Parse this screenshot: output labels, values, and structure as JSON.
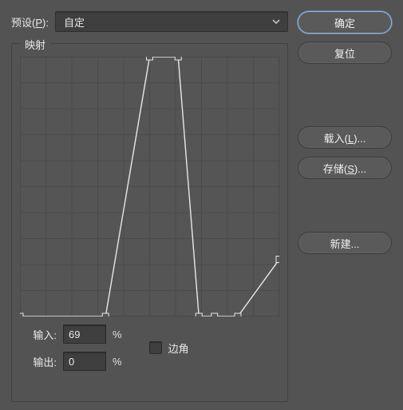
{
  "preset": {
    "label_before": "预设(",
    "label_hotkey": "P",
    "label_after": "):",
    "value": "自定"
  },
  "mapping": {
    "legend": "映射"
  },
  "chart_data": {
    "type": "line",
    "x": [
      0,
      33,
      50,
      61,
      69,
      75,
      84,
      100
    ],
    "y": [
      0,
      0,
      100,
      100,
      0,
      0,
      0,
      22
    ],
    "xlim": [
      0,
      100
    ],
    "ylim": [
      0,
      100
    ],
    "grid": true,
    "title": "",
    "xlabel": "",
    "ylabel": ""
  },
  "io": {
    "input_label": "输入:",
    "input_value": "69",
    "output_label": "输出:",
    "output_value": "0",
    "percent": "%"
  },
  "corner": {
    "label": "边角",
    "checked": false
  },
  "buttons": {
    "ok": "确定",
    "reset": "复位",
    "load_pre": "载入(",
    "load_hot": "L",
    "load_post": ")...",
    "save_pre": "存储(",
    "save_hot": "S",
    "save_post": ")...",
    "new": "新建..."
  }
}
